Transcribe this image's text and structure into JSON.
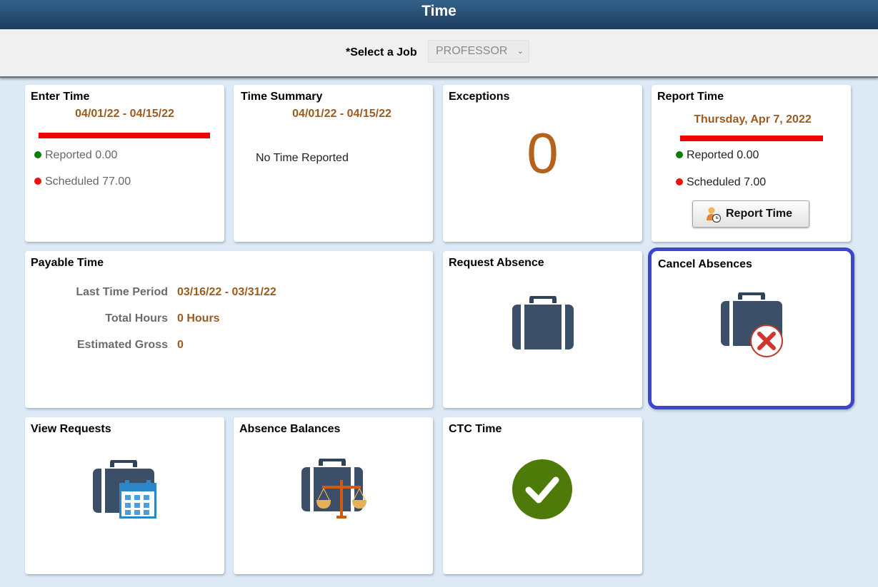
{
  "header": {
    "title": "Time"
  },
  "job_selector": {
    "label": "*Select a Job",
    "selected": "PROFESSOR"
  },
  "tiles": {
    "enter_time": {
      "title": "Enter Time",
      "period": "04/01/22 - 04/15/22",
      "reported": "Reported 0.00",
      "scheduled": "Scheduled 77.00",
      "reported_color": "#0a7d0a",
      "scheduled_color": "#ef1010"
    },
    "time_summary": {
      "title": "Time Summary",
      "period": "04/01/22 - 04/15/22",
      "message": "No Time Reported"
    },
    "exceptions": {
      "title": "Exceptions",
      "count": "0"
    },
    "report_time": {
      "title": "Report Time",
      "date": "Thursday, Apr 7, 2022",
      "reported": "Reported 0.00",
      "scheduled": "Scheduled 7.00",
      "button_label": "Report Time"
    },
    "payable_time": {
      "title": "Payable Time",
      "rows": [
        {
          "label": "Last Time Period",
          "value": "03/16/22 - 03/31/22"
        },
        {
          "label": "Total Hours",
          "value": "0 Hours"
        },
        {
          "label": "Estimated Gross",
          "value": "0"
        }
      ]
    },
    "request_absence": {
      "title": "Request Absence",
      "icon": "briefcase-icon"
    },
    "cancel_absences": {
      "title": "Cancel Absences",
      "icon": "briefcase-cancel-icon"
    },
    "view_requests": {
      "title": "View Requests",
      "icon": "briefcase-calendar-icon"
    },
    "absence_balances": {
      "title": "Absence Balances",
      "icon": "briefcase-scale-icon"
    },
    "ctc_time": {
      "title": "CTC Time",
      "icon": "green-checkmark-icon"
    }
  },
  "colors": {
    "banner": "#1d3d5e",
    "accent_brown": "#9c5a1f",
    "focus_ring": "#3d45d0",
    "status_red": "#ef1010",
    "status_green": "#0a7d0a",
    "check_green": "#4e7a0a"
  }
}
